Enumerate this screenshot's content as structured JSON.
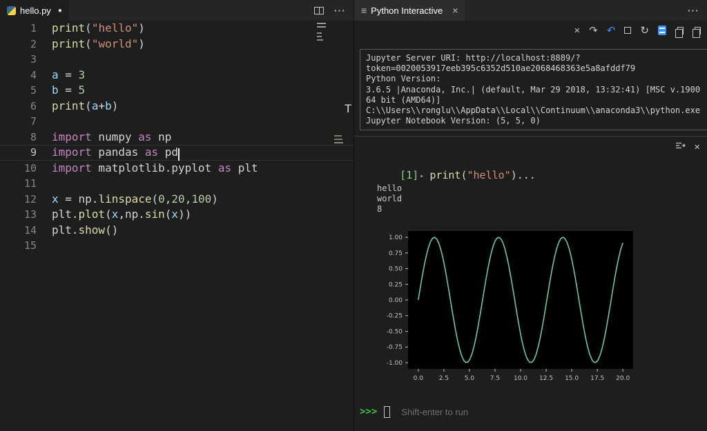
{
  "colors": {
    "accent_blue": "#3794ff",
    "exec_green": "#89d185",
    "prompt_green": "#3ec53e"
  },
  "editor_pane": {
    "tab": {
      "label": "hello.py",
      "modified_dot": "●"
    },
    "tabbar_actions": {
      "more": "⋯"
    },
    "stray_letter": "T",
    "lines": [
      {
        "n": "1",
        "tokens": [
          [
            "fn",
            "print"
          ],
          [
            "pl",
            "("
          ],
          [
            "str",
            "\"hello\""
          ],
          [
            "pl",
            ")"
          ]
        ]
      },
      {
        "n": "2",
        "tokens": [
          [
            "fn",
            "print"
          ],
          [
            "pl",
            "("
          ],
          [
            "str",
            "\"world\""
          ],
          [
            "pl",
            ")"
          ]
        ]
      },
      {
        "n": "3",
        "tokens": []
      },
      {
        "n": "4",
        "tokens": [
          [
            "vr",
            "a"
          ],
          [
            "pl",
            " = "
          ],
          [
            "num",
            "3"
          ]
        ]
      },
      {
        "n": "5",
        "tokens": [
          [
            "vr",
            "b"
          ],
          [
            "pl",
            " = "
          ],
          [
            "num",
            "5"
          ]
        ]
      },
      {
        "n": "6",
        "tokens": [
          [
            "fn",
            "print"
          ],
          [
            "pl",
            "("
          ],
          [
            "vr",
            "a"
          ],
          [
            "pl",
            "+"
          ],
          [
            "vr",
            "b"
          ],
          [
            "pl",
            ")"
          ]
        ]
      },
      {
        "n": "7",
        "tokens": []
      },
      {
        "n": "8",
        "tokens": [
          [
            "kw",
            "import"
          ],
          [
            "pl",
            " numpy "
          ],
          [
            "kw",
            "as"
          ],
          [
            "pl",
            " np"
          ]
        ]
      },
      {
        "n": "9",
        "current": true,
        "cursor": true,
        "tokens": [
          [
            "kw",
            "import"
          ],
          [
            "pl",
            " pandas "
          ],
          [
            "kw",
            "as"
          ],
          [
            "pl",
            " pd"
          ]
        ]
      },
      {
        "n": "10",
        "tokens": [
          [
            "kw",
            "import"
          ],
          [
            "pl",
            " matplotlib.pyplot "
          ],
          [
            "kw",
            "as"
          ],
          [
            "pl",
            " plt"
          ]
        ]
      },
      {
        "n": "11",
        "tokens": []
      },
      {
        "n": "12",
        "tokens": [
          [
            "vr",
            "x"
          ],
          [
            "pl",
            " = np."
          ],
          [
            "fn",
            "linspace"
          ],
          [
            "pl",
            "("
          ],
          [
            "num",
            "0"
          ],
          [
            "pl",
            ","
          ],
          [
            "num",
            "20"
          ],
          [
            "pl",
            ","
          ],
          [
            "num",
            "100"
          ],
          [
            "pl",
            ")"
          ]
        ]
      },
      {
        "n": "13",
        "tokens": [
          [
            "pl",
            "plt."
          ],
          [
            "fn",
            "plot"
          ],
          [
            "pl",
            "("
          ],
          [
            "vr",
            "x"
          ],
          [
            "pl",
            ",np."
          ],
          [
            "fn",
            "sin"
          ],
          [
            "pl",
            "("
          ],
          [
            "vr",
            "x"
          ],
          [
            "pl",
            "))"
          ]
        ]
      },
      {
        "n": "14",
        "tokens": [
          [
            "pl",
            "plt."
          ],
          [
            "fn",
            "show"
          ],
          [
            "pl",
            "()"
          ]
        ]
      },
      {
        "n": "15",
        "tokens": []
      }
    ]
  },
  "interactive_pane": {
    "tab": {
      "icon": "≡",
      "label": "Python Interactive",
      "close": "×"
    },
    "tabbar_more": "⋯",
    "toolbar": {
      "close": "×",
      "redo": "↷",
      "undo": "↶",
      "restart": "↻"
    },
    "server_info": [
      "Jupyter Server URI: http://localhost:8889/?",
      "token=0020053917eeb395c6352d510ae2068468363e5a8afddf79",
      "Python Version:",
      "3.6.5 |Anaconda, Inc.| (default, Mar 29 2018, 13:32:41) [MSC v.1900",
      "64 bit (AMD64)]",
      "C:\\\\Users\\\\ronglu\\\\AppData\\\\Local\\\\Continuum\\\\anaconda3\\\\python.exe",
      "Jupyter Notebook Version: (5, 5, 0)"
    ],
    "cell": {
      "execution_count": "[1]",
      "run_arrow": "▸",
      "close": "×",
      "tokens": [
        [
          "fn",
          "print"
        ],
        [
          "pl",
          "("
        ],
        [
          "str",
          "\"hello\""
        ],
        [
          "pl",
          ")..."
        ]
      ]
    },
    "output_lines": [
      "hello",
      "world",
      "8"
    ],
    "prompt": ">>>",
    "input_placeholder": "Shift-enter to run"
  },
  "chart_data": {
    "type": "line",
    "title": "",
    "xlabel": "",
    "ylabel": "",
    "xlim": [
      -1,
      21
    ],
    "ylim": [
      -1.1,
      1.1
    ],
    "x_ticks": [
      "0.0",
      "2.5",
      "5.0",
      "7.5",
      "10.0",
      "12.5",
      "15.0",
      "17.5",
      "20.0"
    ],
    "y_ticks": [
      "1.00",
      "0.75",
      "0.50",
      "0.25",
      "0.00",
      "-0.25",
      "-0.50",
      "-0.75",
      "-1.00"
    ],
    "series": [
      {
        "name": "np.sin(x)",
        "fn": "sin",
        "x_min": 0,
        "x_max": 20,
        "n_points": 100
      }
    ],
    "line_color": "#72c6a6",
    "plot_bg": "#000000",
    "tick_color": "#c2c2c2",
    "grid": false,
    "legend": false
  }
}
